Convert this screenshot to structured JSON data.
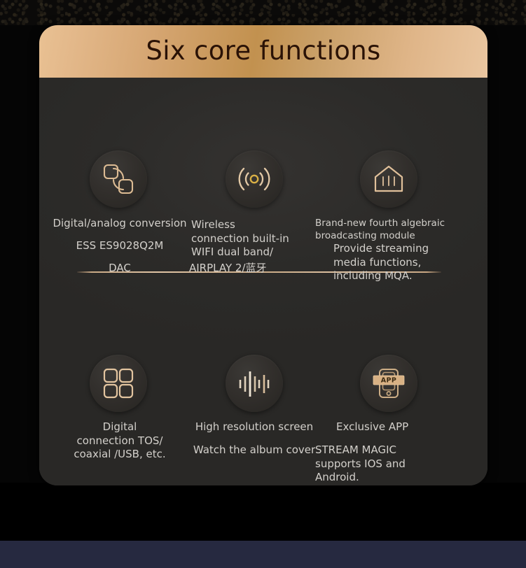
{
  "header": {
    "title": "Six core functions"
  },
  "colors": {
    "header_gold_light": "#e9c193",
    "header_gold_dark": "#c2914f",
    "icon_stroke": "#d9b78e",
    "card_body": "#2d2c2a",
    "text": "#d3d0cb",
    "divider": "#cbab87",
    "page_background": "#050505",
    "bottom_band": "#262940"
  },
  "features": [
    {
      "id": "digital-analog-conversion",
      "icon": "two-rounded-squares-arcs-icon",
      "title": "Digital/analog conversion",
      "line2": "ESS ES9028Q2M",
      "line3": "DAC"
    },
    {
      "id": "wireless-connection",
      "icon": "wireless-signal-icon",
      "title": "Wireless\nconnection built-in\nWIFI dual band/",
      "line2": "AIRPLAY 2/蓝牙",
      "line3": ""
    },
    {
      "id": "streaming-module",
      "icon": "house-streaming-icon",
      "title": "Brand-new fourth algebraic broadcasting module",
      "line2": "Provide streaming\nmedia functions,\nincluding MQA.",
      "line3": ""
    },
    {
      "id": "digital-connection",
      "icon": "four-squares-grid-icon",
      "title": "Digital\nconnection TOS/\ncoaxial /USB, etc.",
      "line2": "",
      "line3": ""
    },
    {
      "id": "high-resolution-screen",
      "icon": "audio-waveform-icon",
      "title": "High resolution screen",
      "line2": "Watch the album cover",
      "line3": ""
    },
    {
      "id": "exclusive-app",
      "icon": "phone-app-icon",
      "title": "Exclusive APP",
      "line2": "STREAM MAGIC\nsupports IOS and\nAndroid.",
      "line3": ""
    }
  ],
  "icon_labels": {
    "app_badge": "APP"
  }
}
